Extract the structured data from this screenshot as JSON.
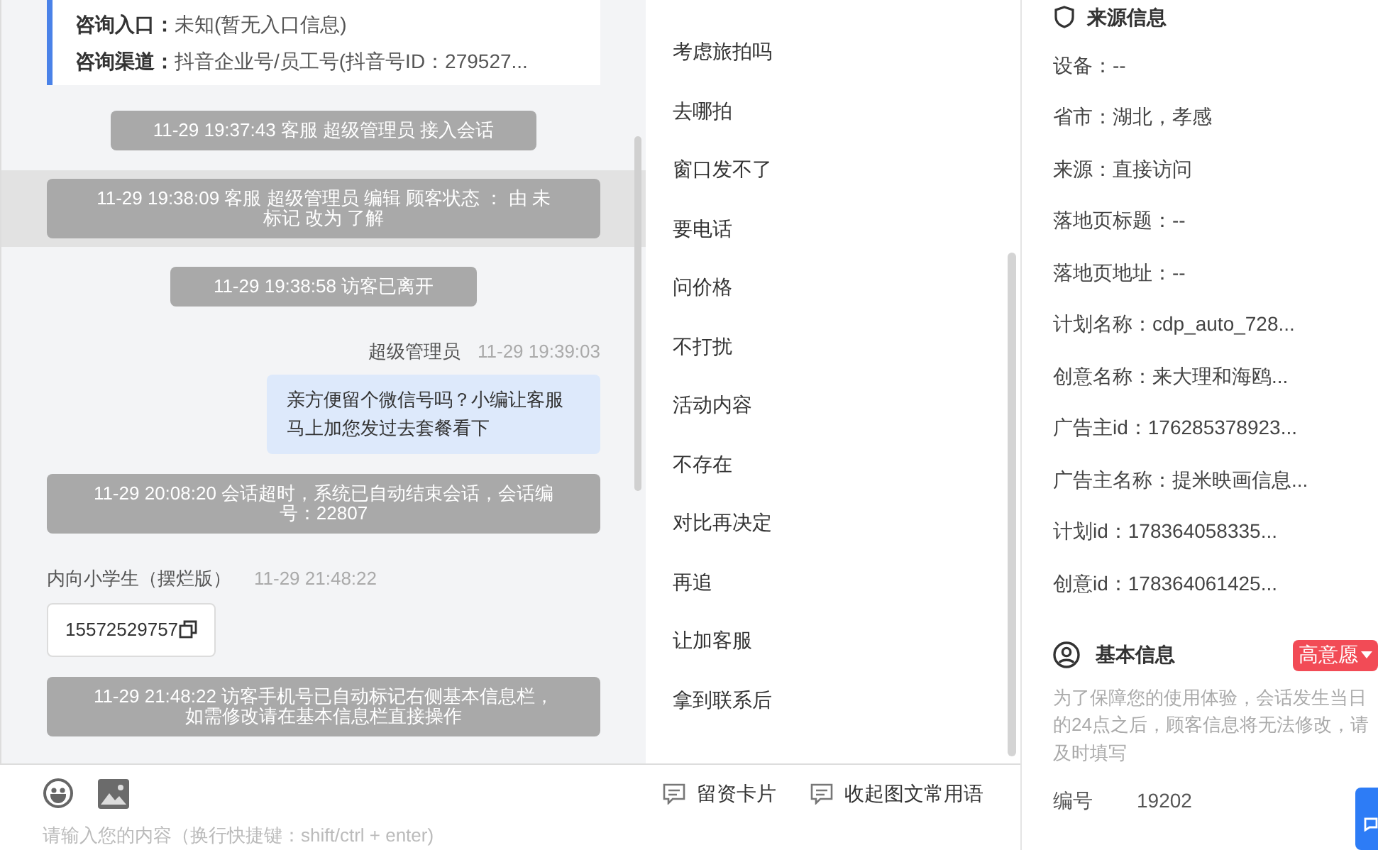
{
  "consult_card": {
    "rows": [
      {
        "label": "咨询入口：",
        "value": "未知(暂无入口信息)"
      },
      {
        "label": "咨询渠道：",
        "value": "抖音企业号/员工号(抖音号ID：279527..."
      }
    ]
  },
  "messages": [
    {
      "kind": "system",
      "highlighted": false,
      "text": "11-29 19:37:43 客服 超级管理员 接入会话"
    },
    {
      "kind": "system",
      "highlighted": true,
      "text": "11-29 19:38:09 客服 超级管理员 编辑 顾客状态 ： 由 未标记 改为 了解"
    },
    {
      "kind": "system",
      "highlighted": false,
      "text": "11-29 19:38:58 访客已离开"
    },
    {
      "kind": "outgoing",
      "highlighted": false,
      "sender": "超级管理员",
      "time": "11-29 19:39:03",
      "text": "亲方便留个微信号吗？小编让客服马上加您发过去套餐看下"
    },
    {
      "kind": "system",
      "highlighted": false,
      "text": "11-29 20:08:20 会话超时，系统已自动结束会话，会话编号：22807"
    },
    {
      "kind": "incoming",
      "highlighted": false,
      "sender": "内向小学生（摆烂版）",
      "time": "11-29 21:48:22",
      "text": "15572529757"
    },
    {
      "kind": "system",
      "highlighted": false,
      "text": "11-29 21:48:22 访客手机号已自动标记右侧基本信息栏，如需修改请在基本信息栏直接操作"
    }
  ],
  "quick_replies": [
    "考虑旅拍吗",
    "去哪拍",
    "窗口发不了",
    "要电话",
    "问价格",
    "不打扰",
    "活动内容",
    "不存在",
    "对比再决定",
    "再追",
    "让加客服",
    "拿到联系后"
  ],
  "toolbar": {
    "buttons": [
      "留资卡片",
      "收起图文常用语"
    ],
    "input": {
      "placeholder": "请输入您的内容（换行快捷键：shift/ctrl + enter)"
    }
  },
  "source_info": {
    "title": "来源信息",
    "rows": [
      "设备：--",
      "省市：湖北，孝感",
      "来源：直接访问",
      "落地页标题：--",
      "落地页地址：--",
      "计划名称：cdp_auto_728...",
      "创意名称：来大理和海鸥...",
      "广告主id：176285378923...",
      "广告主名称：提米映画信息...",
      "计划id：178364058335...",
      "创意id：178364061425..."
    ]
  },
  "basic_info": {
    "title": "基本信息",
    "tag": "高意愿",
    "notice": "为了保障您的使用体验，会话发生当日的24点之后，顾客信息将无法修改，请及时填写",
    "fields": [
      {
        "label": "编号",
        "value": "19202"
      }
    ]
  }
}
